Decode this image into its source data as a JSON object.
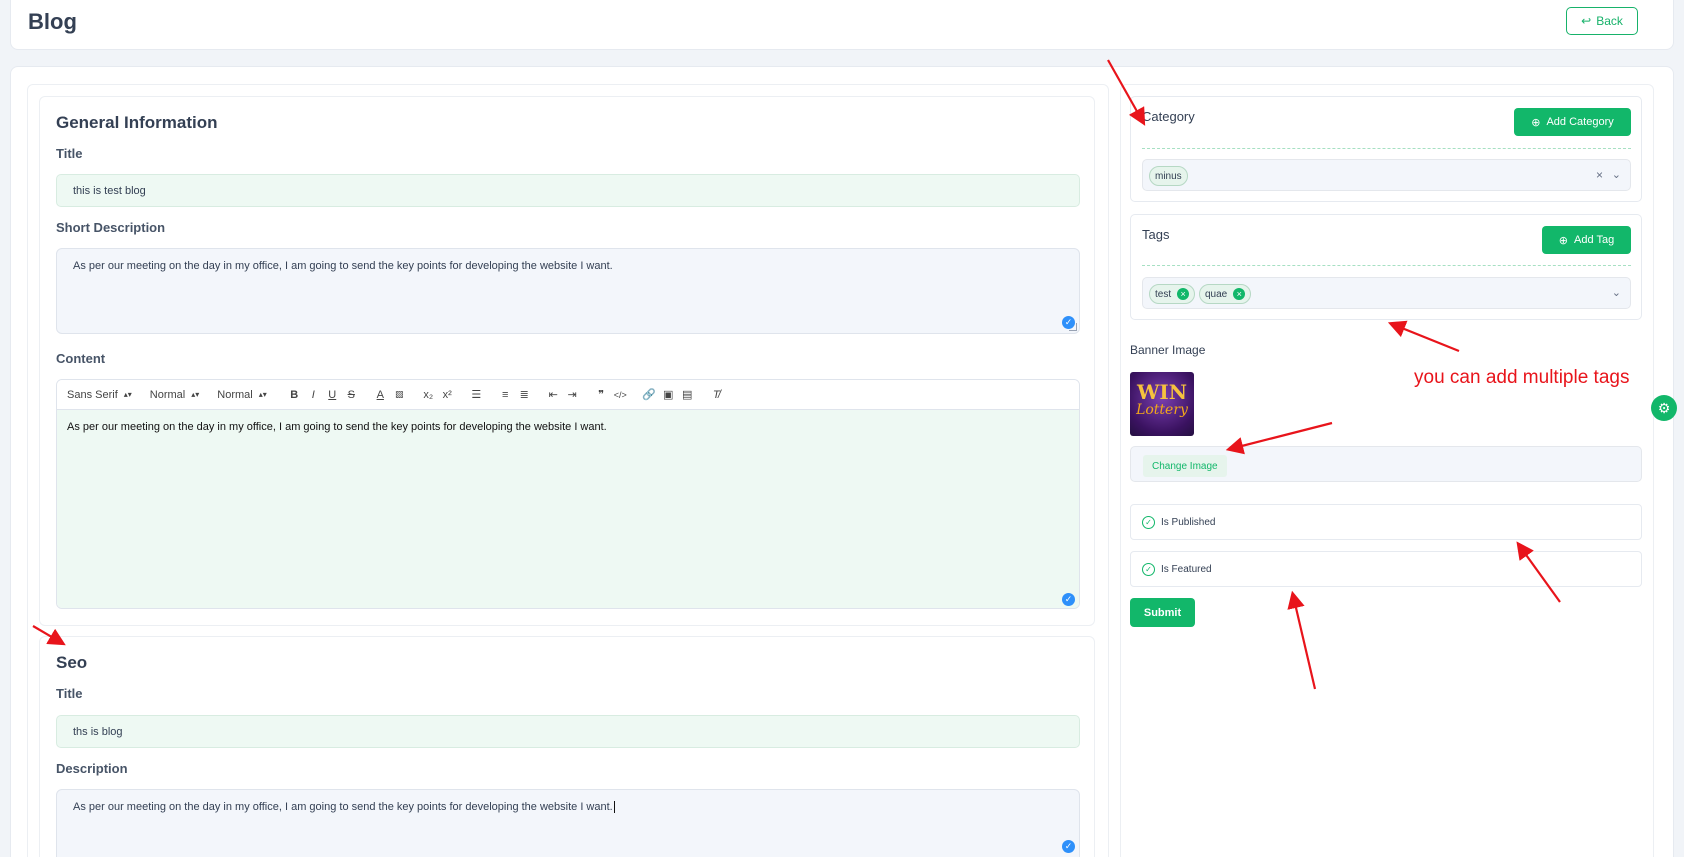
{
  "header": {
    "title": "Blog",
    "back_label": "Back"
  },
  "general": {
    "heading": "General Information",
    "title_label": "Title",
    "title_value": "this is test blog",
    "short_desc_label": "Short Description",
    "short_desc_value": "As per our meeting on the day in my office, I am going to send the key points for developing the website I want.",
    "content_label": "Content",
    "toolbar": {
      "font": "Sans Serif",
      "size": "Normal",
      "heading": "Normal"
    },
    "content_value": "As per our meeting on the day in my office, I am going to send the key points for developing the website I want."
  },
  "seo": {
    "heading": "Seo",
    "title_label": "Title",
    "title_value": "ths is blog",
    "desc_label": "Description",
    "desc_value": "As per our meeting on the day in my office, I am going to send the key points for developing the website I want."
  },
  "category": {
    "label": "Category",
    "add_label": "Add Category",
    "selected": [
      "minus"
    ]
  },
  "tags": {
    "label": "Tags",
    "add_label": "Add Tag",
    "selected": [
      "test",
      "quae"
    ]
  },
  "banner": {
    "label": "Banner Image",
    "image_line1": "WIN",
    "image_line2": "Lottery",
    "change_label": "Change Image"
  },
  "toggles": {
    "published_label": "Is Published",
    "featured_label": "Is Featured"
  },
  "submit_label": "Submit",
  "annotation": "you can add multiple tags",
  "colors": {
    "accent": "#12b76a",
    "annotation": "#e8141b"
  }
}
